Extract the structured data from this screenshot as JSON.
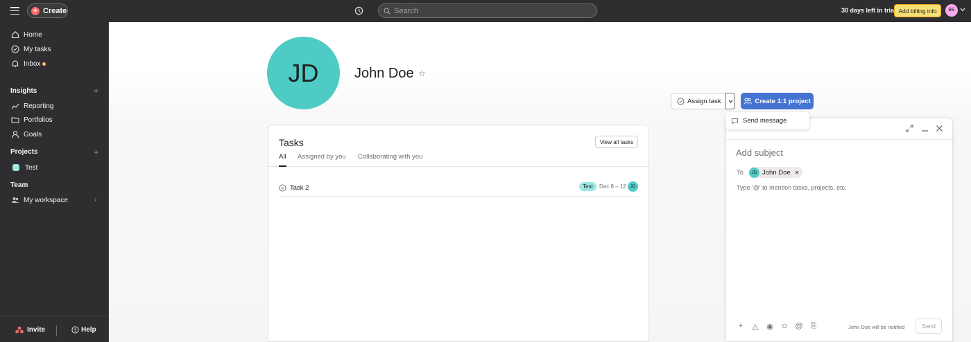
{
  "topbar": {
    "create_label": "Create",
    "search_placeholder": "Search",
    "trial_text": "30 days left in trial",
    "billing_label": "Add billing info",
    "user_initials": "BE"
  },
  "sidebar": {
    "home": "Home",
    "my_tasks": "My tasks",
    "inbox": "Inbox",
    "insights_header": "Insights",
    "reporting": "Reporting",
    "portfolios": "Portfolios",
    "goals": "Goals",
    "projects_header": "Projects",
    "project_test": "Test",
    "team_header": "Team",
    "my_workspace": "My workspace",
    "invite": "Invite",
    "help": "Help"
  },
  "profile": {
    "initials": "JD",
    "name": "John Doe",
    "assign_task": "Assign task",
    "create_project": "Create 1:1 project",
    "send_message": "Send message"
  },
  "tasks": {
    "title": "Tasks",
    "view_all": "View all tasks",
    "tabs": [
      "All",
      "Assigned by you",
      "Collaborating with you"
    ],
    "rows": [
      {
        "name": "Task 2",
        "tag": "Test",
        "date": "Dec 8 – 12",
        "assignee": "JD"
      }
    ]
  },
  "message": {
    "subject_placeholder": "Add subject",
    "to_label": "To",
    "recipient_initials": "JD",
    "recipient_name": "John Doe",
    "body_placeholder": "Type '@' to mention tasks, projects, etc.",
    "notified_text": "John Doe will be notified",
    "send_label": "Send"
  },
  "colors": {
    "accent_blue": "#4573d2",
    "avatar_teal": "#4ecbc4",
    "billing_yellow": "#f8df72",
    "sidebar_bg": "#2e2e30"
  }
}
